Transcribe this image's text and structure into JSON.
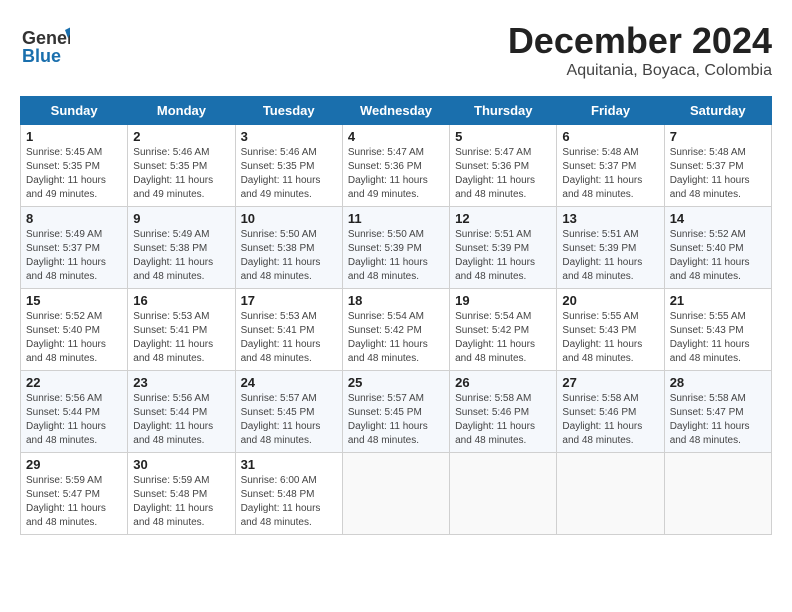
{
  "header": {
    "logo_line1": "General",
    "logo_line2": "Blue",
    "month_title": "December 2024",
    "location": "Aquitania, Boyaca, Colombia"
  },
  "calendar": {
    "weekdays": [
      "Sunday",
      "Monday",
      "Tuesday",
      "Wednesday",
      "Thursday",
      "Friday",
      "Saturday"
    ],
    "weeks": [
      [
        {
          "day": "1",
          "sunrise": "5:45 AM",
          "sunset": "5:35 PM",
          "daylight": "11 hours and 49 minutes."
        },
        {
          "day": "2",
          "sunrise": "5:46 AM",
          "sunset": "5:35 PM",
          "daylight": "11 hours and 49 minutes."
        },
        {
          "day": "3",
          "sunrise": "5:46 AM",
          "sunset": "5:35 PM",
          "daylight": "11 hours and 49 minutes."
        },
        {
          "day": "4",
          "sunrise": "5:47 AM",
          "sunset": "5:36 PM",
          "daylight": "11 hours and 49 minutes."
        },
        {
          "day": "5",
          "sunrise": "5:47 AM",
          "sunset": "5:36 PM",
          "daylight": "11 hours and 48 minutes."
        },
        {
          "day": "6",
          "sunrise": "5:48 AM",
          "sunset": "5:37 PM",
          "daylight": "11 hours and 48 minutes."
        },
        {
          "day": "7",
          "sunrise": "5:48 AM",
          "sunset": "5:37 PM",
          "daylight": "11 hours and 48 minutes."
        }
      ],
      [
        {
          "day": "8",
          "sunrise": "5:49 AM",
          "sunset": "5:37 PM",
          "daylight": "11 hours and 48 minutes."
        },
        {
          "day": "9",
          "sunrise": "5:49 AM",
          "sunset": "5:38 PM",
          "daylight": "11 hours and 48 minutes."
        },
        {
          "day": "10",
          "sunrise": "5:50 AM",
          "sunset": "5:38 PM",
          "daylight": "11 hours and 48 minutes."
        },
        {
          "day": "11",
          "sunrise": "5:50 AM",
          "sunset": "5:39 PM",
          "daylight": "11 hours and 48 minutes."
        },
        {
          "day": "12",
          "sunrise": "5:51 AM",
          "sunset": "5:39 PM",
          "daylight": "11 hours and 48 minutes."
        },
        {
          "day": "13",
          "sunrise": "5:51 AM",
          "sunset": "5:39 PM",
          "daylight": "11 hours and 48 minutes."
        },
        {
          "day": "14",
          "sunrise": "5:52 AM",
          "sunset": "5:40 PM",
          "daylight": "11 hours and 48 minutes."
        }
      ],
      [
        {
          "day": "15",
          "sunrise": "5:52 AM",
          "sunset": "5:40 PM",
          "daylight": "11 hours and 48 minutes."
        },
        {
          "day": "16",
          "sunrise": "5:53 AM",
          "sunset": "5:41 PM",
          "daylight": "11 hours and 48 minutes."
        },
        {
          "day": "17",
          "sunrise": "5:53 AM",
          "sunset": "5:41 PM",
          "daylight": "11 hours and 48 minutes."
        },
        {
          "day": "18",
          "sunrise": "5:54 AM",
          "sunset": "5:42 PM",
          "daylight": "11 hours and 48 minutes."
        },
        {
          "day": "19",
          "sunrise": "5:54 AM",
          "sunset": "5:42 PM",
          "daylight": "11 hours and 48 minutes."
        },
        {
          "day": "20",
          "sunrise": "5:55 AM",
          "sunset": "5:43 PM",
          "daylight": "11 hours and 48 minutes."
        },
        {
          "day": "21",
          "sunrise": "5:55 AM",
          "sunset": "5:43 PM",
          "daylight": "11 hours and 48 minutes."
        }
      ],
      [
        {
          "day": "22",
          "sunrise": "5:56 AM",
          "sunset": "5:44 PM",
          "daylight": "11 hours and 48 minutes."
        },
        {
          "day": "23",
          "sunrise": "5:56 AM",
          "sunset": "5:44 PM",
          "daylight": "11 hours and 48 minutes."
        },
        {
          "day": "24",
          "sunrise": "5:57 AM",
          "sunset": "5:45 PM",
          "daylight": "11 hours and 48 minutes."
        },
        {
          "day": "25",
          "sunrise": "5:57 AM",
          "sunset": "5:45 PM",
          "daylight": "11 hours and 48 minutes."
        },
        {
          "day": "26",
          "sunrise": "5:58 AM",
          "sunset": "5:46 PM",
          "daylight": "11 hours and 48 minutes."
        },
        {
          "day": "27",
          "sunrise": "5:58 AM",
          "sunset": "5:46 PM",
          "daylight": "11 hours and 48 minutes."
        },
        {
          "day": "28",
          "sunrise": "5:58 AM",
          "sunset": "5:47 PM",
          "daylight": "11 hours and 48 minutes."
        }
      ],
      [
        {
          "day": "29",
          "sunrise": "5:59 AM",
          "sunset": "5:47 PM",
          "daylight": "11 hours and 48 minutes."
        },
        {
          "day": "30",
          "sunrise": "5:59 AM",
          "sunset": "5:48 PM",
          "daylight": "11 hours and 48 minutes."
        },
        {
          "day": "31",
          "sunrise": "6:00 AM",
          "sunset": "5:48 PM",
          "daylight": "11 hours and 48 minutes."
        },
        null,
        null,
        null,
        null
      ]
    ]
  },
  "labels": {
    "sunrise": "Sunrise:",
    "sunset": "Sunset:",
    "daylight": "Daylight:"
  }
}
